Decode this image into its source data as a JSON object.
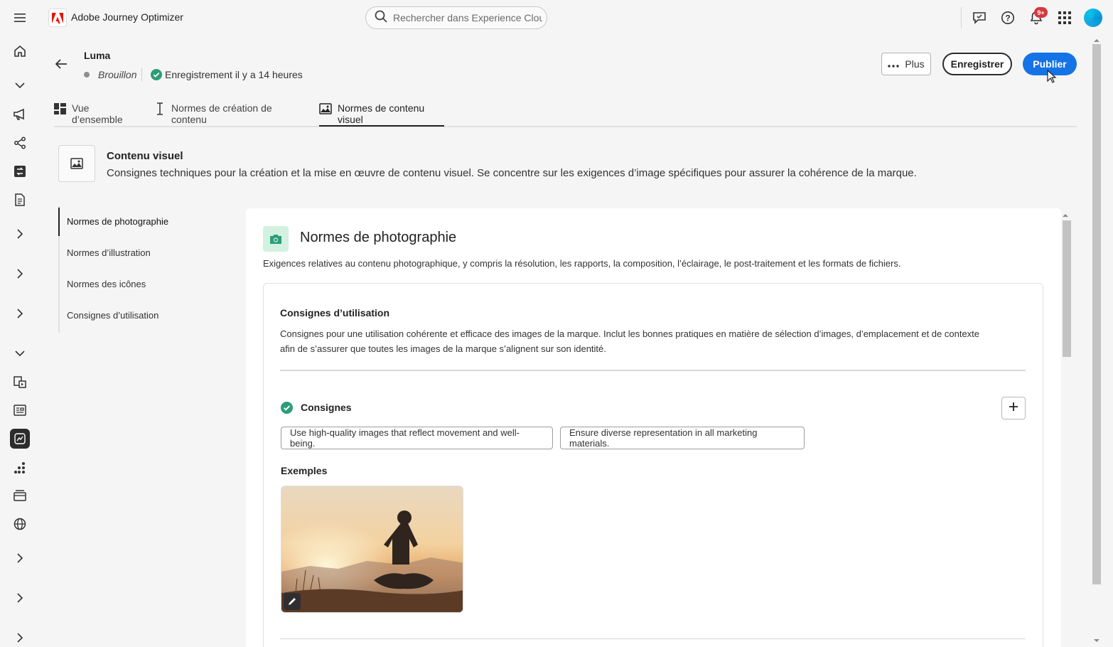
{
  "app": {
    "title": "Adobe Journey Optimizer",
    "search_placeholder": "Rechercher dans Experience Cloud...",
    "notification_badge": "9+"
  },
  "header": {
    "title": "Luma",
    "status": "Brouillon",
    "save_status": "Enregistrement il y a 14 heures",
    "more_label": "Plus",
    "save_label": "Enregistrer",
    "publish_label": "Publier"
  },
  "tabs": [
    {
      "label": "Vue d’ensemble",
      "icon": "dashboard-icon"
    },
    {
      "label": "Normes de création de contenu",
      "icon": "text-cursor-icon"
    },
    {
      "label": "Normes de contenu visuel",
      "icon": "image-icon",
      "active": true
    }
  ],
  "section": {
    "title": "Contenu visuel",
    "description": "Consignes techniques pour la création et la mise en œuvre de contenu visuel. Se concentre sur les exigences d’image spécifiques pour assurer la cohérence de la marque."
  },
  "subnav": [
    {
      "label": "Normes de photographie",
      "active": true
    },
    {
      "label": "Normes d’illustration"
    },
    {
      "label": "Normes des icônes"
    },
    {
      "label": "Consignes d’utilisation"
    }
  ],
  "main": {
    "title": "Normes de photographie",
    "description": "Exigences relatives au contenu photographique, y compris la résolution, les rapports, la composition, l’éclairage, le post-traitement et les formats de fichiers.",
    "usage": {
      "title": "Consignes d’utilisation",
      "description": "Consignes pour une utilisation cohérente et efficace des images de la marque. Inclut les bonnes pratiques en matière de sélection d’images, d’emplacement et de contexte afin de s’assurer que toutes les images de la marque s’alignent sur son identité."
    },
    "guidelines_title": "Consignes",
    "guidelines": [
      "Use high-quality images that reflect movement and well-being.",
      "Ensure diverse representation in all marketing materials."
    ],
    "examples_title": "Exemples"
  },
  "colors": {
    "accent": "#1473e6",
    "success": "#2d9d78",
    "badge": "#d7373f",
    "photo_icon_bg": "#d3f1e0"
  }
}
